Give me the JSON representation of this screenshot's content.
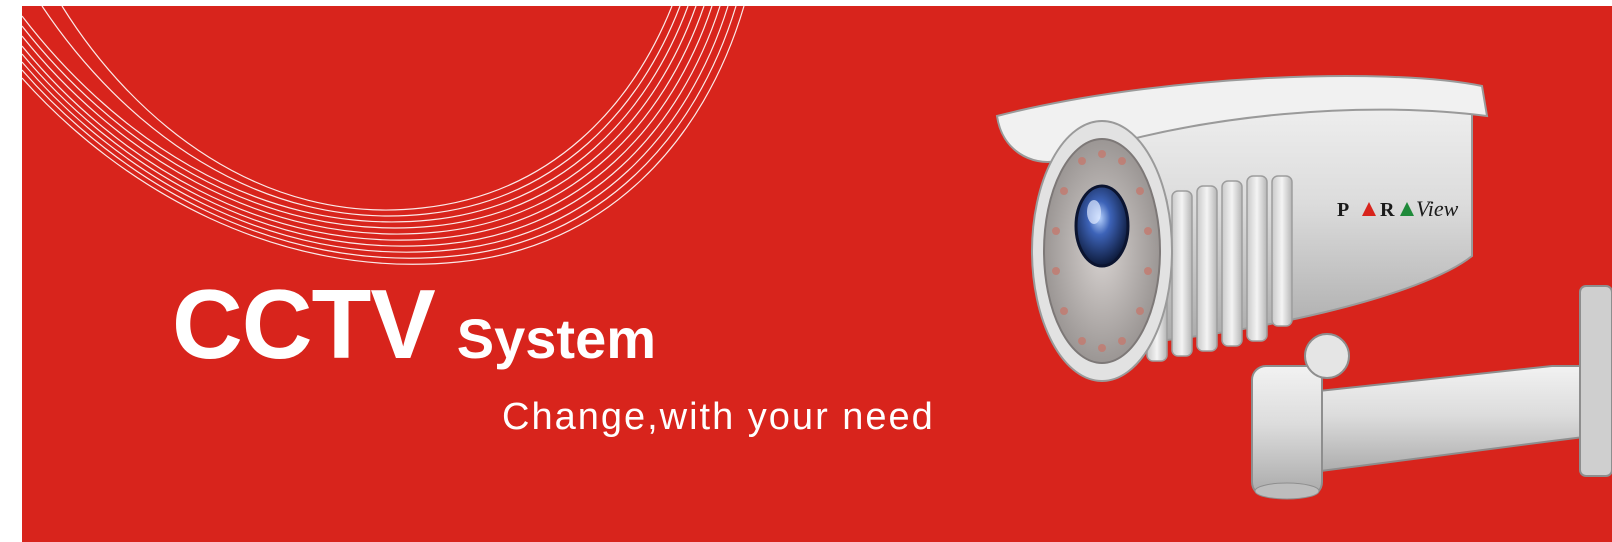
{
  "banner": {
    "title_main": "CCTV",
    "title_sub": "System",
    "tagline": "Change,with  your need",
    "background_color": "#d8241c"
  },
  "camera": {
    "brand_letters": [
      "P",
      "A",
      "R",
      "A"
    ],
    "brand_script": "View",
    "brand_colors": {
      "letters": "#1a1a1a",
      "triangle_red": "#d8241c",
      "triangle_green": "#1f8a3a"
    }
  }
}
